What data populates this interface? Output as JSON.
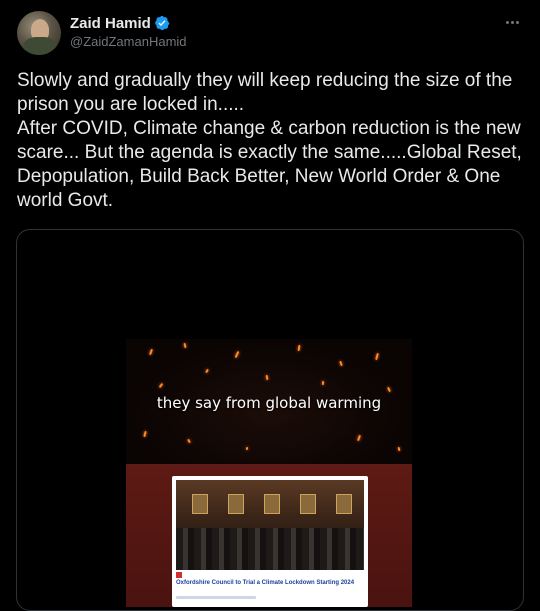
{
  "author": {
    "display_name": "Zaid Hamid",
    "handle": "@ZaidZamanHamid",
    "verified": true
  },
  "tweet": {
    "text": "Slowly and gradually they will keep reducing the size of the prison you are locked in.....\nAfter COVID, Climate change & carbon reduction is the new scare... But the agenda is exactly the same.....Global Reset, Depopulation, Build Back Better, New World Order & One world Govt."
  },
  "media": {
    "caption": "they say from global warming",
    "article_badge": "",
    "article_headline": "Oxfordshire Council to Trial a Climate Lockdown Starting 2024"
  },
  "icons": {
    "more": "more-options-icon",
    "verified": "verified-badge-icon"
  },
  "colors": {
    "background": "#000000",
    "text": "#e7e9ea",
    "secondary": "#71767b",
    "verified": "#1d9bf0",
    "border": "#2f3336"
  }
}
